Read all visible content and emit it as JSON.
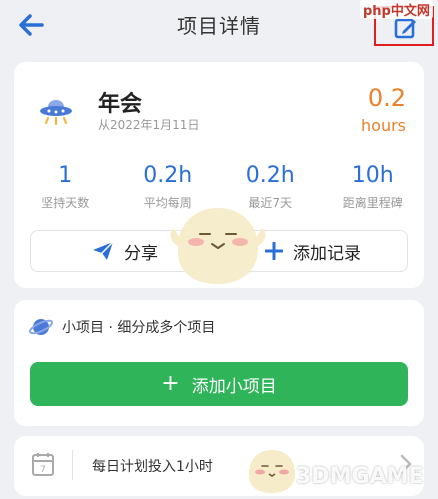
{
  "header": {
    "title": "项目详情",
    "back_icon": "arrow-left-icon",
    "edit_icon": "edit-icon",
    "watermark": "php中文网"
  },
  "project": {
    "name": "年会",
    "start_date": "从2022年1月11日",
    "total_value": "0.2",
    "total_unit": "hours",
    "icon": "ufo-icon"
  },
  "stats": [
    {
      "value": "1",
      "label": "坚持天数"
    },
    {
      "value": "0.2h",
      "label": "平均每周"
    },
    {
      "value": "0.2h",
      "label": "最近7天"
    },
    {
      "value": "10h",
      "label": "距离里程碑"
    }
  ],
  "actions": {
    "share_label": "分享",
    "add_record_label": "添加记录"
  },
  "subprojects": {
    "header_text": "小项目 · 细分成多个项目",
    "add_button_label": "添加小项目"
  },
  "plan": {
    "text": "每日计划投入1小时"
  },
  "watermark_bottom": "3DMGAME",
  "colors": {
    "accent_blue": "#2a6fd8",
    "accent_orange": "#e8812a",
    "accent_green": "#2fb45a",
    "highlight_red": "#e02020"
  }
}
